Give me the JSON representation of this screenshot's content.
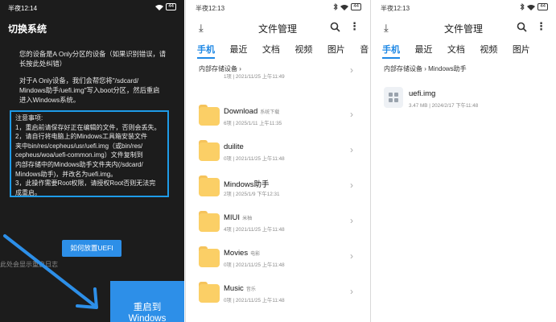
{
  "panel1": {
    "time": "半夜12:14",
    "battery": "44",
    "title": "切换系统",
    "para1": [
      "您的设备是A Only分区的设备（如果识别错误，请",
      "长按此处纠错）"
    ],
    "para2": [
      "对于A Only设备，我们会帮您将\"/sdcard/",
      "Mindows助手/uefi.img\"写入boot分区，然后重启",
      "进入Windows系统。"
    ],
    "notice": [
      "注意事项:",
      "1，重启前请保存好正在编辑的文件，否则会丢失。",
      "2，请自行将电脑上的Mindows工具箱安装文件",
      "夹中bin/res/cepheus/usr/uefi.img（或bin/res/",
      "cepheus/woa/uefi-common.img）文件复制到",
      "内部存储中的Mindows助手文件夹内(/sdcard/",
      "Mindows助手)，并改名为uefi.img。",
      "3，此操作需要Root权限，请授权Root否则无法完",
      "成重启。"
    ],
    "uefi_button": "如何放置UEFI",
    "faint_text": "此处会显示重启日志",
    "reboot_button": [
      "重启到",
      "Windows"
    ]
  },
  "panel2": {
    "time": "半夜12:13",
    "battery": "44",
    "title": "文件管理",
    "tabs": [
      "手机",
      "最近",
      "文档",
      "视频",
      "图片",
      "音"
    ],
    "breadcrumb": "内部存储设备",
    "partial_meta": "1项 | 2021/11/25 上午11:49",
    "rows": [
      {
        "name": "Download",
        "tag": "系统下载",
        "meta": "6项 | 2025/1/11 上午11:35"
      },
      {
        "name": "duilite",
        "tag": "",
        "meta": "0项 | 2021/11/25 上午11:48"
      },
      {
        "name": "Mindows助手",
        "tag": "",
        "meta": "2项 | 2025/1/9 下午12:31"
      },
      {
        "name": "MIUI",
        "tag": "米柚",
        "meta": "4项 | 2021/11/25 上午11:48"
      },
      {
        "name": "Movies",
        "tag": "电影",
        "meta": "0项 | 2021/11/25 上午11:48"
      },
      {
        "name": "Music",
        "tag": "音乐",
        "meta": "0项 | 2021/11/25 上午11:48"
      }
    ]
  },
  "panel3": {
    "time": "半夜12:13",
    "battery": "44",
    "title": "文件管理",
    "tabs": [
      "手机",
      "最近",
      "文档",
      "视频",
      "图片"
    ],
    "breadcrumb_root": "内部存储设备",
    "breadcrumb_folder": "Mindows助手",
    "file": {
      "name": "uefi.img",
      "meta": "3.47 MB | 2024/2/17 下午11:48"
    }
  },
  "colors": {
    "accent": "#1e88e5",
    "notice_border": "#1e9be8",
    "button": "#2d8fe8",
    "folder": "#fbcf66",
    "dark_bg": "#1c1c1c"
  },
  "icons": [
    "wifi-icon",
    "battery-icon",
    "bluetooth-icon",
    "download-icon",
    "search-icon",
    "more-icon",
    "folder-icon",
    "chevron-right-icon",
    "file-icon",
    "swipe-arrow-icon"
  ]
}
